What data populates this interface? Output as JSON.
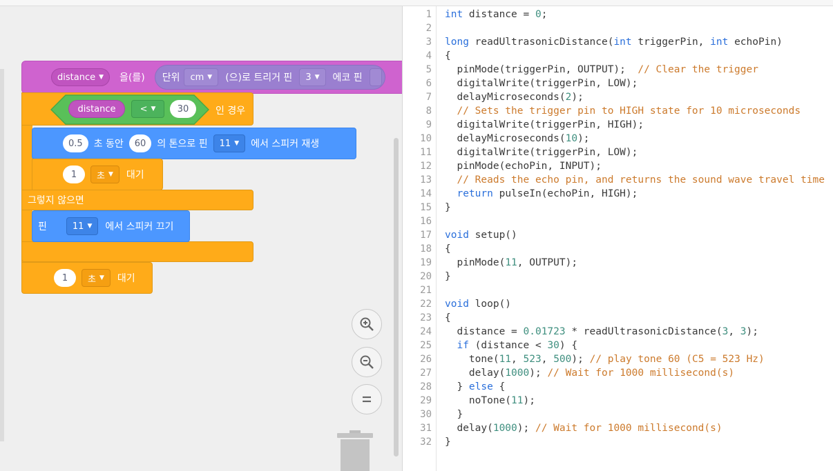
{
  "blocks": {
    "set_var": {
      "variable": "distance",
      "op_label": "을(를)",
      "sensor": {
        "unit_label": "단위",
        "unit": "cm",
        "mid_label": "(으)로 트리거 핀",
        "trigger_pin": "3",
        "echo_label": "에코 핀"
      }
    },
    "if_block": {
      "variable": "distance",
      "operator": "<",
      "value": "30",
      "label": "인 경우"
    },
    "play_tone": {
      "seconds": "0.5",
      "label_seconds": "초 동안",
      "note": "60",
      "label_tone": "의 톤으로 핀",
      "pin": "11",
      "label_end": "에서 스피커 재생"
    },
    "wait_inner": {
      "value": "1",
      "unit": "초",
      "label": "대기"
    },
    "else_label": "그렇지 않으면",
    "stop_tone": {
      "label_pin": "핀",
      "pin": "11",
      "label_end": "에서 스피커 끄기"
    },
    "wait_outer": {
      "value": "1",
      "unit": "초",
      "label": "대기"
    }
  },
  "zoom_controls": [
    "zoom-in-icon",
    "zoom-out-icon",
    "zoom-reset-icon"
  ],
  "editor": {
    "line_numbers": [
      "1",
      "2",
      "3",
      "4",
      "5",
      "6",
      "7",
      "8",
      "9",
      "10",
      "11",
      "12",
      "13",
      "14",
      "15",
      "16",
      "17",
      "18",
      "19",
      "20",
      "21",
      "22",
      "23",
      "24",
      "25",
      "26",
      "27",
      "28",
      "29",
      "30",
      "31",
      "32"
    ],
    "lines": [
      "int distance = 0;",
      "",
      "long readUltrasonicDistance(int triggerPin, int echoPin)",
      "{",
      "  pinMode(triggerPin, OUTPUT);  // Clear the trigger",
      "  digitalWrite(triggerPin, LOW);",
      "  delayMicroseconds(2);",
      "  // Sets the trigger pin to HIGH state for 10 microseconds",
      "  digitalWrite(triggerPin, HIGH);",
      "  delayMicroseconds(10);",
      "  digitalWrite(triggerPin, LOW);",
      "  pinMode(echoPin, INPUT);",
      "  // Reads the echo pin, and returns the sound wave travel time",
      "  return pulseIn(echoPin, HIGH);",
      "}",
      "",
      "void setup()",
      "{",
      "  pinMode(11, OUTPUT);",
      "}",
      "",
      "void loop()",
      "{",
      "  distance = 0.01723 * readUltrasonicDistance(3, 3);",
      "  if (distance < 30) {",
      "    tone(11, 523, 500); // play tone 60 (C5 = 523 Hz)",
      "    delay(1000); // Wait for 1000 millisecond(s)",
      "  } else {",
      "    noTone(11);",
      "  }",
      "  delay(1000); // Wait for 1000 millisecond(s)",
      "}"
    ]
  },
  "colors": {
    "control": "#ffab19",
    "sound": "#4c97ff",
    "operator": "#59c059",
    "variable": "#cf63cf",
    "sensing": "#a18ad4",
    "keyword": "#2a6fdb",
    "comment": "#cc7a2c",
    "number": "#3f8f7f"
  }
}
